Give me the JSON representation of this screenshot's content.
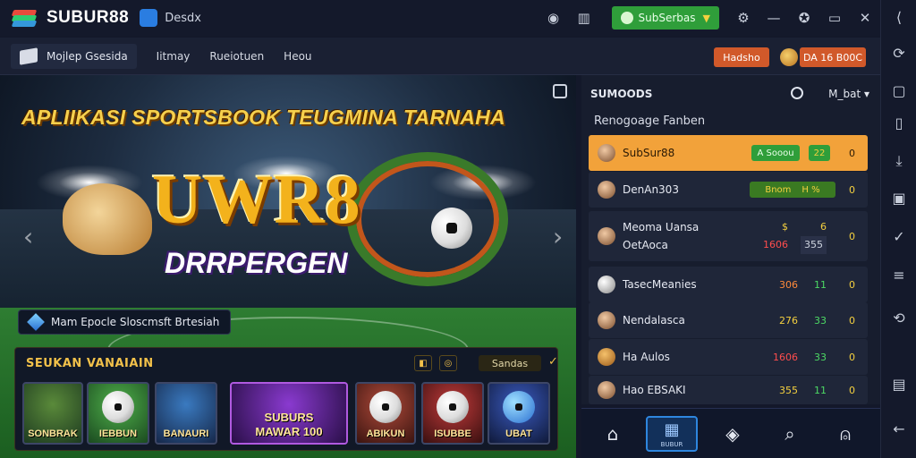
{
  "titlebar": {
    "brand": "SUBUR88",
    "tab_label": "Desdx",
    "green_button": "SubSerbas",
    "icons": [
      "record-icon",
      "stats-icon",
      "shield-icon",
      "minimize-icon",
      "pin-icon",
      "close-icon",
      "collapse-icon"
    ]
  },
  "nav": {
    "home": "Mojlep Gsesida",
    "links": [
      "Iitmay",
      "Rueiotuen",
      "Heou"
    ],
    "orange_button": "Hadsho",
    "user_button": "DA 16 B00C"
  },
  "banner": {
    "headline": "APLIIKASI SPORTSBOOK TEUGMINA TARNAHA",
    "logo_main": "UWR8",
    "logo_sub": "DRRPERGEN",
    "pill": "Mam Epocle Sloscmsft Brtesiah"
  },
  "games": {
    "title": "SEUKAN VANAIAIN",
    "ctl_label": "Sandas",
    "cards": [
      {
        "label": "SONBRAK"
      },
      {
        "label": "IEBBUN"
      },
      {
        "label": "BANAURI"
      },
      {
        "label": "SUBURS\nMAWAR 100"
      },
      {
        "label": "ABIKUN"
      },
      {
        "label": "ISUBBE"
      },
      {
        "label": "UBAT"
      }
    ]
  },
  "panel": {
    "header": "SUMOODS",
    "select": "M_bat",
    "subhead": "Renogoage Fanben",
    "rows": [
      {
        "name": "SubSur88",
        "chip": "A Sooou",
        "chip2": "22",
        "num": "0",
        "selected": true
      },
      {
        "name": "DenAn303",
        "chip": "Bnom",
        "chip2": "H %",
        "num": "0",
        "selected": false
      },
      {
        "name": "Meoma Uansa",
        "name2": "OetAoca",
        "a": "$",
        "a2": "1606",
        "b": "6",
        "b2": "355",
        "num": "0"
      },
      {
        "name": "TasecMeanies",
        "a": "306",
        "b": "11",
        "num": "0"
      },
      {
        "name": "Nendalasca",
        "a": "276",
        "b": "33",
        "num": "0"
      },
      {
        "name": "Ha Aulos",
        "a": "1606",
        "b": "33",
        "num": "0"
      },
      {
        "name": "Hao EBSAKI",
        "a": "355",
        "b": "11",
        "num": "0"
      }
    ]
  },
  "bottom_nav": {
    "active_label": "BUBUR",
    "icons": [
      "home-icon",
      "store-icon",
      "cube-icon",
      "search-icon",
      "bag-icon"
    ]
  },
  "sidebar_icons": [
    "screen-rotate-icon",
    "screenshot-icon",
    "copy-icon",
    "install-icon",
    "record-icon",
    "list-icon",
    "sync-icon",
    "message-icon",
    "back-icon"
  ],
  "colors": {
    "accent_green": "#2f9e3a",
    "accent_orange": "#d1592a",
    "gold": "#f2c14a",
    "bg": "#13182a"
  }
}
